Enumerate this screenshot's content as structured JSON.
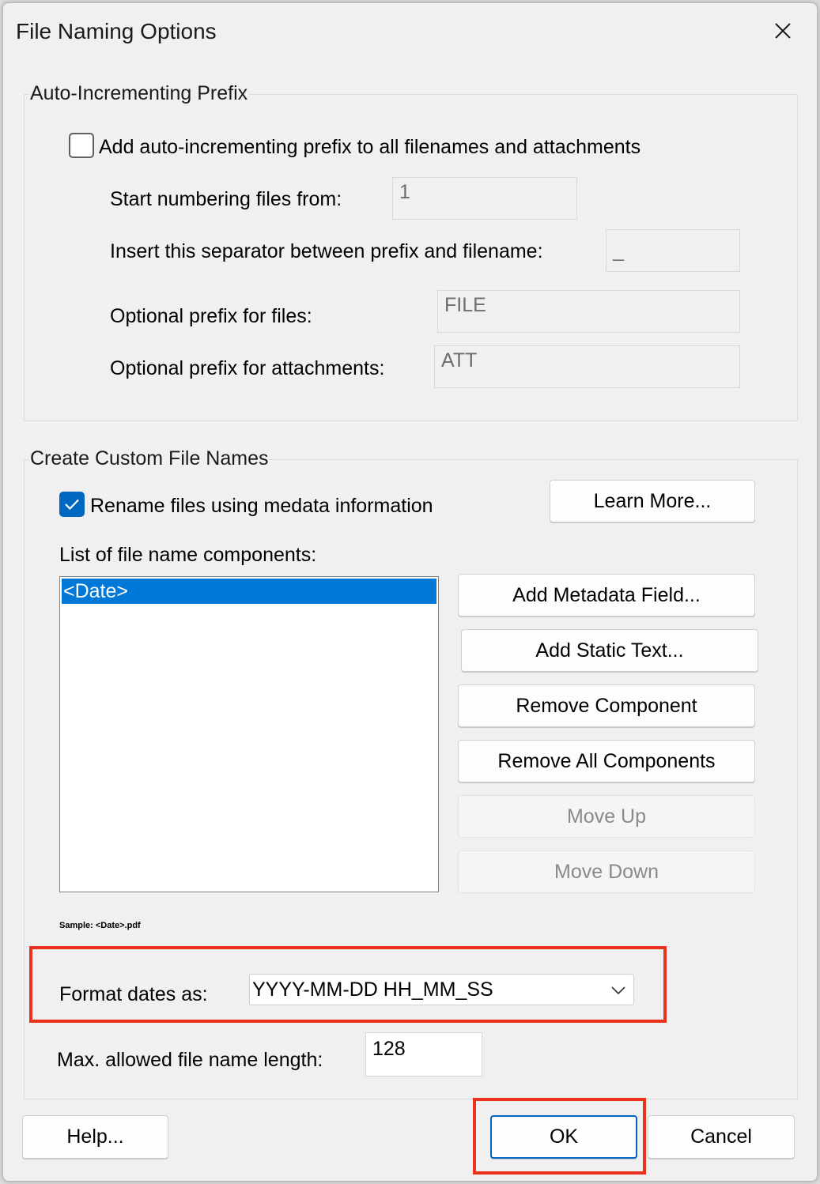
{
  "window": {
    "title": "File Naming Options"
  },
  "prefix_group": {
    "title": "Auto-Incrementing Prefix",
    "checkbox_label": "Add auto-incrementing prefix to all filenames and attachments",
    "checked": false,
    "start_label": "Start numbering files from:",
    "start_value": "1",
    "separator_label": "Insert this separator between prefix and filename:",
    "separator_value": "_",
    "file_prefix_label": "Optional prefix for files:",
    "file_prefix_value": "FILE",
    "att_prefix_label": "Optional prefix for attachments:",
    "att_prefix_value": "ATT"
  },
  "custom_group": {
    "title": "Create Custom File Names",
    "rename_label": "Rename files using medata information",
    "rename_checked": true,
    "learn_more": "Learn More...",
    "list_label": "List of file name components:",
    "components": [
      "<Date>"
    ],
    "buttons": {
      "add_metadata": "Add Metadata Field...",
      "add_static": "Add Static Text...",
      "remove": "Remove Component",
      "remove_all": "Remove All Components",
      "move_up": "Move Up",
      "move_down": "Move Down"
    },
    "sample": "Sample: <Date>.pdf",
    "format_label": "Format dates as:",
    "format_value": "YYYY-MM-DD HH_MM_SS",
    "max_label": "Max. allowed file name length:",
    "max_value": "128"
  },
  "footer": {
    "help": "Help...",
    "ok": "OK",
    "cancel": "Cancel"
  },
  "colors": {
    "accent": "#0067c0",
    "selection": "#0078d7",
    "highlight": "#e8321c"
  },
  "icons": {
    "close": "close-icon",
    "check": "checkmark-icon",
    "dropdown": "chevron-down-icon"
  }
}
